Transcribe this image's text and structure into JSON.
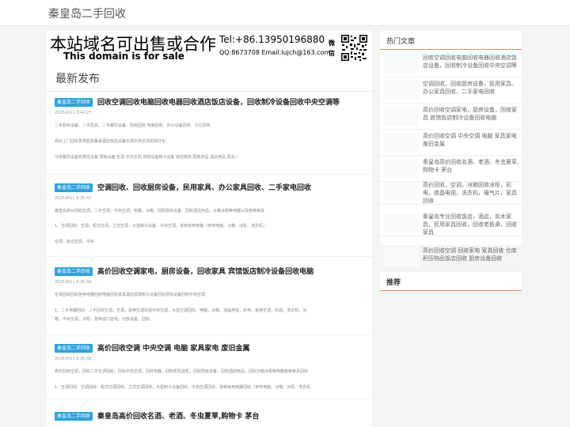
{
  "site": {
    "title": "秦皇岛二手回收"
  },
  "banner": {
    "cn": "本站域名可出售或合作",
    "en": "This domain is for sale",
    "tel": "Tel:+86.13950196880",
    "qq": "QQ:8673708 Email:lujch@163.com",
    "wechat": "微信"
  },
  "section_title": "最新发布",
  "articles": [
    {
      "badge": "秦皇岛二手回收",
      "title": "回收空调回收电脑回收电器回收酒店饭店设备，回收制冷设备回收中央空调等",
      "date": "2025/4/11 8:44:27",
      "lines": [
        "二手厨房设备、二手厨具、二手餐饮设备、厨房回收 电脑回收、办公设备回收、工位回收",
        "高价上门回收各类厨具餐桌酒店饭店设备空调中央空调拆除打包",
        "冷库餐饮设备奶茶店设备 厨房设备 空调 中央空调 烘焙设备制冷设备 饭店物资 厨房用品 酒店用品 厨具~"
      ]
    },
    {
      "badge": "秦皇岛二手回收",
      "title": "空调回收、回收厨房设备，民用家具、办公家具回收、二手家电回收",
      "date": "2025/4/11 8:35:47",
      "lines": [
        "秦皇岛高价回收空调，二手空调，中央空调，电器，冰箱，回收厨房设备，回收酒店用品，冰箱冰柜等电器以及各种家具",
        "1、空调回收：空调，柜式空调，立式空调，大型制冷设备，中央空调，各种家用电器（家电电脑、冰箱、冰柜、洗衣机。）",
        "空调：各式空调，中央"
      ]
    },
    {
      "badge": "秦皇岛二手回收",
      "title": "高价回收空调家电，厨房设备，回收家具 宾馆饭店制冷设备回收电脑",
      "date": "2025/4/11 8:35:40",
      "lines": [
        "空调回收回收各种电器回收电脑回收家具酒店宾馆制冷设备回收厨房设备回收中央空调",
        "1、二手电器回收：二手回收空调，空调，各种空调机组中央空调，大型空调回收，电脑，冰箱，液晶电视，彩电，各种空调，机组，洗衣机，冰",
        "箱，中央空调，冰柜，各种进口音响，功放设备，回收。"
      ]
    },
    {
      "badge": "秦皇岛二手回收",
      "title": "高价回收空调 中央空调 电脑 家具家电 废旧金属",
      "date": "2025/4/11 8:35:33",
      "lines": [
        "高价回收空调，回收二手空调回收，回收中央空调，回收电器，回收柜机挂机，回收厨房设备，回收酒店用品，回收冰箱冰柜等电器各种家具回收",
        "1、空调回收：空调回收，柜式空调回收，立式空调回收，大型制冷设备回收，中央空调回收，各种家用电器回收（家电电脑、冰箱、冰柜、洗衣机"
      ]
    },
    {
      "badge": "秦皇岛二手回收",
      "title": "秦皇岛高价回收名酒、老酒、冬虫夏草,购物卡 茅台",
      "date": "",
      "lines": []
    }
  ],
  "sidebar": {
    "hot_title": "热门文章",
    "hot_items": [
      "回收空调回收电脑回收电器回收酒店饭店设备，回收制冷设备回收中央空调等",
      "空调回收、回收厨房设备，民用家具、办公家具回收、二手家电回收",
      "高价回收空调家电，厨房设备，回收家具 宾馆饭店制冷设备回收电脑",
      "高价回收空调 中央空调 电脑 家具家电 废旧金属",
      "秦皇岛高价回收名酒、老酒、冬虫夏草,购物卡 茅台",
      "高价回收，空调，冰箱回收冰柜，彩电，夜晶电视，洗衣机，暖气片，家具回收",
      "秦皇岛专业回收饭店，酒店，实木家具，民用家具回收，回收老板桌，回收家具",
      "高价回收空调 回收家电 家具回收 仓库积压物品饭店回收 厨房设备回收"
    ],
    "recommend_title": "推荐"
  }
}
